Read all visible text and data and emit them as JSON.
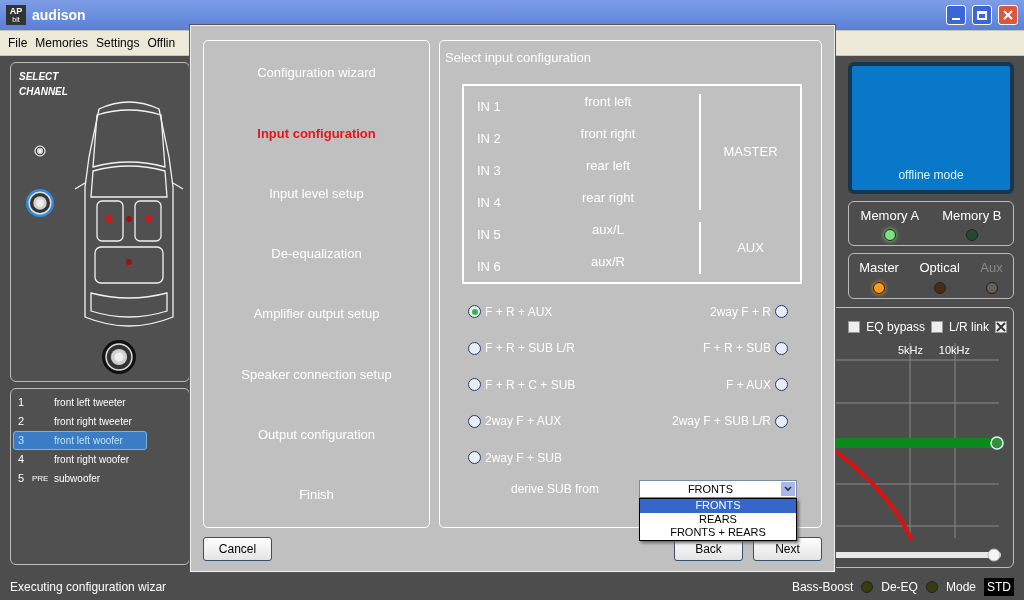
{
  "window": {
    "title": "audison",
    "logo": {
      "top": "AP",
      "bottom": "bit"
    }
  },
  "menu": [
    {
      "label": "File"
    },
    {
      "label": "Memories"
    },
    {
      "label": "Settings"
    },
    {
      "label": "Offlin"
    }
  ],
  "channel_panel": {
    "title": "SELECT CHANNEL"
  },
  "channels": [
    {
      "number": "1",
      "name": "front left tweeter",
      "selected": false
    },
    {
      "number": "2",
      "name": "front right tweeter",
      "selected": false
    },
    {
      "number": "3",
      "name": "front left woofer",
      "selected": true
    },
    {
      "number": "4",
      "name": "front right woofer",
      "selected": false
    },
    {
      "number": "5",
      "tag": "PRE",
      "name": "subwoofer",
      "selected": false
    }
  ],
  "screen": {
    "text": "offline mode"
  },
  "memories": [
    {
      "label": "Memory A",
      "on": true
    },
    {
      "label": "Memory B",
      "on": false
    }
  ],
  "sources": [
    {
      "label": "Master",
      "on": true,
      "disabled": false
    },
    {
      "label": "Optical",
      "on": false,
      "disabled": false
    },
    {
      "label": "Aux",
      "on": false,
      "disabled": true
    }
  ],
  "eq": {
    "checkboxes": [
      {
        "label": "EQ bypass",
        "checked": false
      },
      {
        "label": "L/R link",
        "checked": false
      },
      {
        "checked": true
      }
    ],
    "freq_labels": [
      "5kHz",
      "10kHz"
    ],
    "slider": {
      "level": 1
    }
  },
  "dialog": {
    "steps": [
      {
        "label": "Configuration wizard",
        "selected": false
      },
      {
        "label": "Input configuration",
        "selected": true
      },
      {
        "label": "Input level setup",
        "selected": false
      },
      {
        "label": "De-equalization",
        "selected": false
      },
      {
        "label": "Amplifier output setup",
        "selected": false
      },
      {
        "label": "Speaker connection setup",
        "selected": false
      },
      {
        "label": "Output configuration",
        "selected": false
      },
      {
        "label": "Finish",
        "selected": false
      }
    ],
    "heading": "Select input configuration",
    "groups": [
      {
        "label": "MASTER",
        "inputs": [
          {
            "input": "IN 1",
            "signal": "front left"
          },
          {
            "input": "IN 2",
            "signal": "front right"
          },
          {
            "input": "IN 3",
            "signal": "rear left"
          },
          {
            "input": "IN 4",
            "signal": "rear right"
          }
        ]
      },
      {
        "label": "AUX",
        "inputs": [
          {
            "input": "IN 5",
            "signal": "aux/L"
          },
          {
            "input": "IN 6",
            "signal": "aux/R"
          }
        ]
      }
    ],
    "options_left": [
      {
        "label": "F + R + AUX",
        "selected": true
      },
      {
        "label": "F + R + SUB L/R",
        "selected": false
      },
      {
        "label": "F + R + C + SUB",
        "selected": false
      },
      {
        "label": "2way F + AUX",
        "selected": false
      },
      {
        "label": "2way F + SUB",
        "selected": false
      }
    ],
    "options_right": [
      {
        "label": "2way F + R",
        "selected": false
      },
      {
        "label": "F + R + SUB",
        "selected": false
      },
      {
        "label": "F + AUX",
        "selected": false
      },
      {
        "label": "2way F + SUB L/R",
        "selected": false
      }
    ],
    "derive_sub": {
      "label": "derive SUB from",
      "value": "FRONTS",
      "options": [
        {
          "label": "FRONTS",
          "selected": true
        },
        {
          "label": "REARS",
          "selected": false
        },
        {
          "label": "FRONTS + REARS",
          "selected": false
        }
      ]
    },
    "buttons": {
      "cancel": "Cancel",
      "back": "Back",
      "next": "Next"
    }
  },
  "status_bar": {
    "message": "Executing configuration wizar",
    "indicators": [
      {
        "label": "Bass-Boost",
        "on": false
      },
      {
        "label": "De-EQ",
        "on": false
      }
    ],
    "mode_label": "Mode",
    "mode": "STD"
  }
}
